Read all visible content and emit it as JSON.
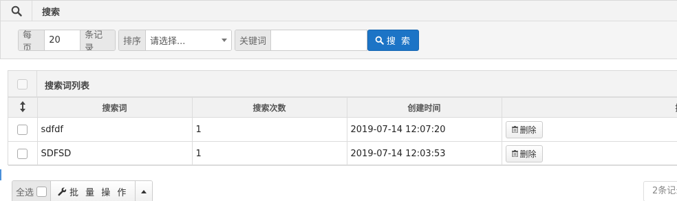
{
  "search_panel": {
    "title": "搜索",
    "per_page_label": "每页",
    "per_page_value": "20",
    "records_label": "条记录",
    "sort_label": "排序",
    "sort_selected": "请选择...",
    "keyword_label": "关键词",
    "keyword_value": "",
    "search_button": "搜 索"
  },
  "list_panel": {
    "title": "搜索词列表",
    "columns": [
      "搜索词",
      "搜索次数",
      "创建时间",
      "操"
    ],
    "rows": [
      {
        "term": "sdfdf",
        "count": "1",
        "created": "2019-07-14 12:07:20",
        "delete_label": "删除"
      },
      {
        "term": "SDFSD",
        "count": "1",
        "created": "2019-07-14 12:03:53",
        "delete_label": "删除"
      }
    ]
  },
  "footer": {
    "select_all_label": "全选",
    "batch_label": "批 量 操 作",
    "total_text": "2条记录"
  },
  "icons": {
    "search": "search-icon",
    "sort_handle": "sort-handle-icon",
    "trash": "trash-icon",
    "wrench": "wrench-icon"
  },
  "colors": {
    "primary": "#1c74c6",
    "panel_bg": "#f5f5f5",
    "border": "#d9d9d9"
  }
}
